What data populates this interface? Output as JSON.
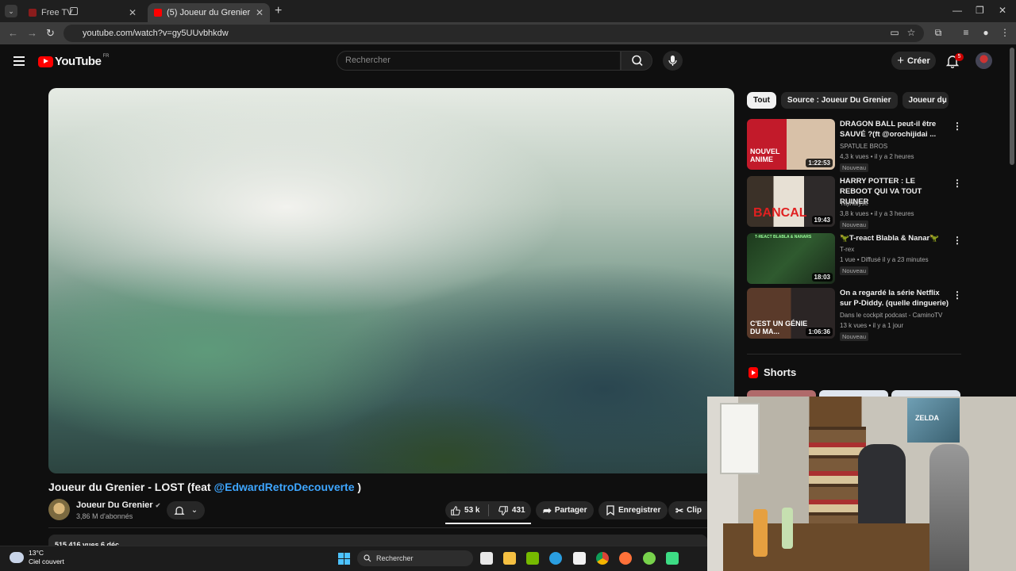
{
  "browser": {
    "tabs": [
      {
        "title": "Free TV",
        "active": false
      },
      {
        "title": "(5) Joueur du Grenier - LOST (fe",
        "active": true
      }
    ],
    "url": "youtube.com/watch?v=gy5UUvbhkdw"
  },
  "youtube": {
    "logo_text": "YouTube",
    "country": "FR",
    "search_placeholder": "Rechercher",
    "create_label": "Créer",
    "notifications": "5"
  },
  "video": {
    "title_prefix": "Joueur du Grenier - LOST (feat ",
    "title_mention": "@EdwardRetroDecouverte",
    "title_suffix": " )",
    "channel": "Joueur Du Grenier",
    "verified_mark": "✔",
    "subscribers": "3,86 M d'abonnés",
    "likes": "53 k",
    "dislikes": "431",
    "share_label": "Partager",
    "save_label": "Enregistrer",
    "clip_label": "Clip",
    "views_date": "515 416 vues  6 déc."
  },
  "chips": [
    "Tout",
    "Source : Joueur Du Grenier",
    "Joueur du G"
  ],
  "recommendations": [
    {
      "title": "DRAGON BALL peut-il être SAUVÉ ?(ft @orochijidai ...",
      "channel": "SPATULE BROS",
      "meta": "4,3 k vues • il y a 2 heures",
      "duration": "1:22:53",
      "badge": "Nouveau",
      "thumb_text": "NOUVEL ANIME"
    },
    {
      "title": "HARRY POTTER : LE REBOOT QUI VA TOUT RUINER",
      "channel": "Yajinalyse",
      "meta": "3,8 k vues • il y a 3 heures",
      "duration": "19:43",
      "badge": "Nouveau",
      "thumb_text": "BANCAL"
    },
    {
      "title": "🦖T-react Blabla & Nanar🦖",
      "channel": "T-rex",
      "meta": "1 vue • Diffusé il y a 23 minutes",
      "duration": "18:03",
      "badge": "Nouveau",
      "thumb_text": "T-REACT BLABLA & NANARS"
    },
    {
      "title": "On a regardé la série Netflix sur P-Diddy. (quelle dinguerie)",
      "channel": "Dans le cockpit podcast - CaminoTV",
      "meta": "13 k vues • il y a 1 jour",
      "duration": "1:06:36",
      "badge": "Nouveau",
      "thumb_text": "C'EST UN GÉNIE DU MA..."
    }
  ],
  "shorts_label": "Shorts",
  "webcam": {
    "poster_text": "ZELDA"
  },
  "taskbar": {
    "temperature": "13°C",
    "weather": "Ciel couvert",
    "search_label": "Rechercher"
  }
}
